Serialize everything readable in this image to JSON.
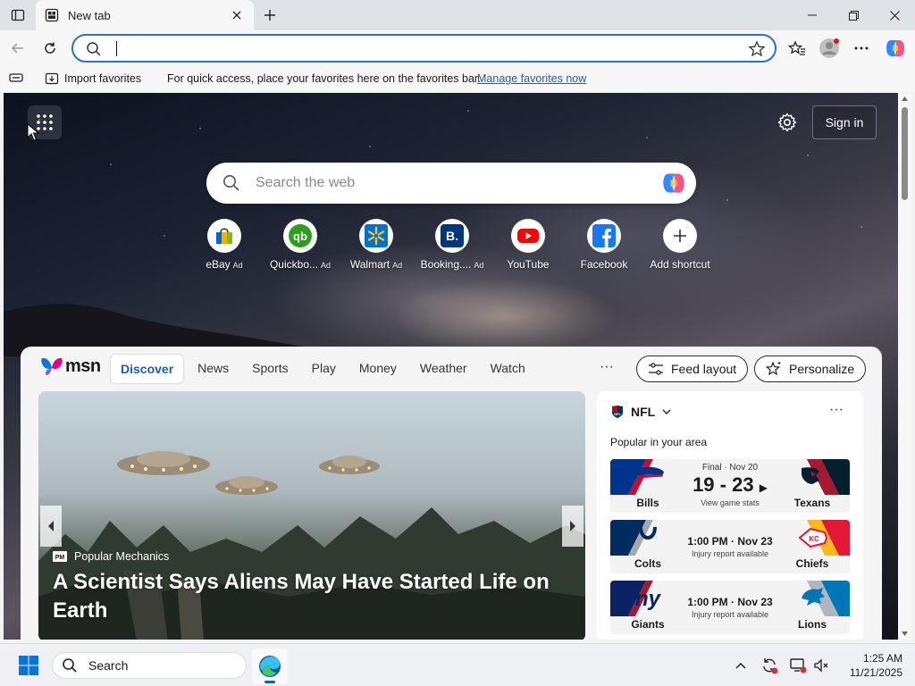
{
  "browser": {
    "tab": {
      "title": "New tab"
    },
    "address_bar": {
      "value": "",
      "placeholder": ""
    },
    "favorites_bar": {
      "import_label": "Import favorites",
      "message": "For quick access, place your favorites here on the favorites bar.",
      "manage_link": "Manage favorites now"
    }
  },
  "newtab": {
    "sign_in_label": "Sign in",
    "search_placeholder": "Search the web",
    "shortcuts": [
      {
        "label": "eBay",
        "ad": "Ad",
        "icon": "ebay-icon"
      },
      {
        "label": "Quickbo...",
        "ad": "Ad",
        "icon": "quickbooks-icon"
      },
      {
        "label": "Walmart",
        "ad": "Ad",
        "icon": "walmart-icon"
      },
      {
        "label": "Booking....",
        "ad": "Ad",
        "icon": "booking-icon"
      },
      {
        "label": "YouTube",
        "ad": "",
        "icon": "youtube-icon"
      },
      {
        "label": "Facebook",
        "ad": "",
        "icon": "facebook-icon"
      },
      {
        "label": "Add shortcut",
        "ad": "",
        "icon": "plus-icon"
      }
    ]
  },
  "feed": {
    "logo_text": "msn",
    "tabs": [
      "Discover",
      "News",
      "Sports",
      "Play",
      "Money",
      "Weather",
      "Watch"
    ],
    "more": "···",
    "feed_layout_label": "Feed layout",
    "personalize_label": "Personalize",
    "hero": {
      "source": "Popular Mechanics",
      "title": "A Scientist Says Aliens May Have Started Life on Earth"
    },
    "nfl": {
      "league": "NFL",
      "subtitle": "Popular in your area",
      "more": "···",
      "games": [
        {
          "home": "Bills",
          "away": "Texans",
          "status": "Final · Nov 20",
          "score": "19 - 23",
          "note": "View game stats",
          "time": ""
        },
        {
          "home": "Colts",
          "away": "Chiefs",
          "status": "",
          "score": "",
          "note": "Injury report available",
          "time": "1:00 PM · Nov 23"
        },
        {
          "home": "Giants",
          "away": "Lions",
          "status": "",
          "score": "",
          "note": "Injury report available",
          "time": "1:00 PM · Nov 23"
        }
      ]
    }
  },
  "taskbar": {
    "search_label": "Search",
    "time": "1:25 AM",
    "date": "11/21/2025"
  },
  "colors": {
    "accent": "#1a5fb4",
    "address_border": "#2a6fd1",
    "bills": "#00338d",
    "texans": "#03202f",
    "colts": "#002c5f",
    "chiefs": "#e31837",
    "giants": "#0b2265",
    "lions": "#0076b6"
  }
}
